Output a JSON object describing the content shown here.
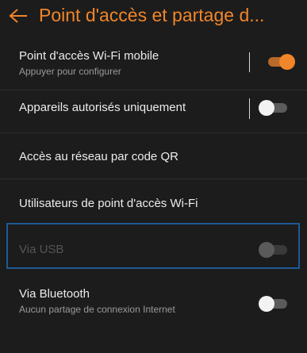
{
  "header": {
    "title": "Point d'accès et partage d...",
    "accent_color": "#f0852a",
    "back_icon": "arrow-left-icon"
  },
  "items": [
    {
      "title": "Point d'accès Wi-Fi mobile",
      "subtitle": "Appuyer pour configurer",
      "toggle": "on",
      "enabled": true
    },
    {
      "title": "Appareils autorisés uniquement",
      "toggle": "off",
      "enabled": true
    },
    {
      "title": "Accès au réseau par code QR",
      "enabled": true
    },
    {
      "title": "Utilisateurs de point d'accès Wi-Fi",
      "enabled": true
    },
    {
      "title": "Via USB",
      "toggle": "off",
      "enabled": false,
      "focused": true
    },
    {
      "title": "Via Bluetooth",
      "subtitle": "Aucun partage de connexion Internet",
      "toggle": "off",
      "enabled": true
    }
  ],
  "colors": {
    "background": "#1c1c1c",
    "toggle_on_track": "#b86a2a",
    "toggle_on_knob": "#f0852a",
    "toggle_off_track": "#5b5b5b",
    "toggle_off_knob": "#f2f2f2",
    "focus_outline": "#1e5a96"
  }
}
